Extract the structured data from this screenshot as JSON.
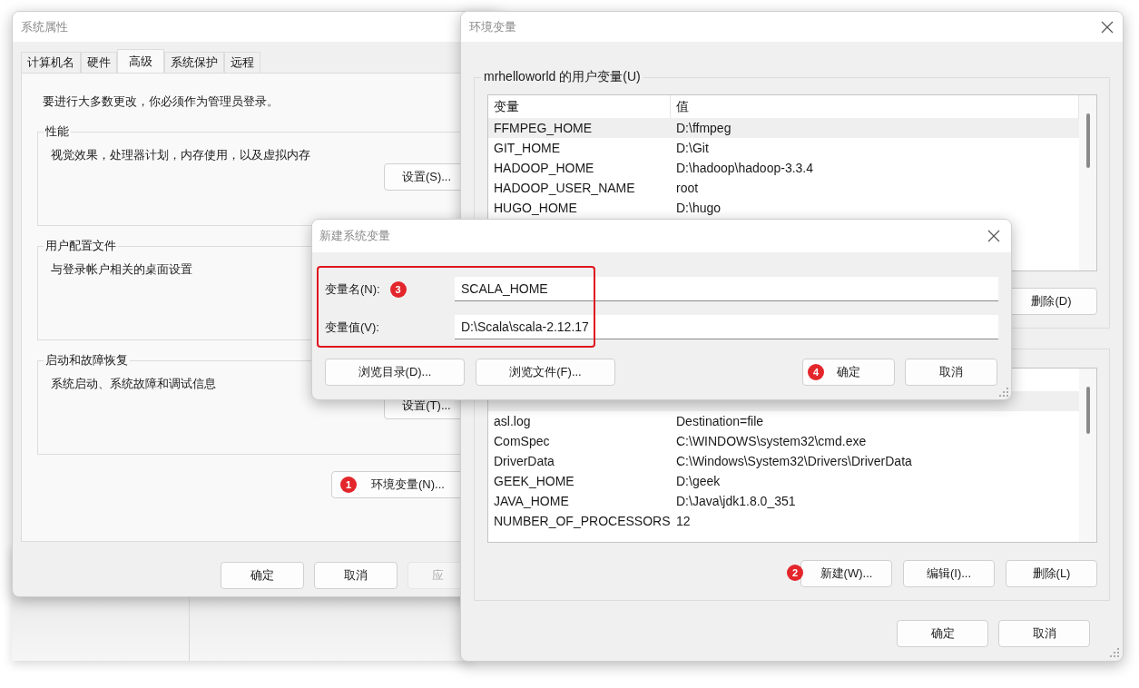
{
  "system_properties": {
    "title": "系统属性",
    "tabs": [
      {
        "label": "计算机名",
        "selected": false
      },
      {
        "label": "硬件",
        "selected": false
      },
      {
        "label": "高级",
        "selected": true
      },
      {
        "label": "系统保护",
        "selected": false
      },
      {
        "label": "远程",
        "selected": false
      }
    ],
    "notice": "要进行大多数更改，你必须作为管理员登录。",
    "groups": [
      {
        "title": "性能",
        "description": "视觉效果，处理器计划，内存使用，以及虚拟内存",
        "button": "设置(S)..."
      },
      {
        "title": "用户配置文件",
        "description": "与登录帐户相关的桌面设置"
      },
      {
        "title": "启动和故障恢复",
        "description": "系统启动、系统故障和调试信息",
        "button": "设置(T)..."
      }
    ],
    "env_button": {
      "label": "环境变量(N)...",
      "step": "1"
    },
    "buttons": [
      {
        "label": "确定",
        "disabled": false
      },
      {
        "label": "取消",
        "disabled": false
      },
      {
        "label": "应",
        "disabled": true
      }
    ]
  },
  "environment_variables": {
    "title": "环境变量",
    "user_variables": {
      "title": "mrhelloworld 的用户变量(U)",
      "columns": [
        "变量",
        "值"
      ],
      "rows": [
        {
          "name": "FFMPEG_HOME",
          "value": "D:\\ffmpeg",
          "selected": true
        },
        {
          "name": "GIT_HOME",
          "value": "D:\\Git",
          "selected": false
        },
        {
          "name": "HADOOP_HOME",
          "value": "D:\\hadoop\\hadoop-3.3.4",
          "selected": false
        },
        {
          "name": "HADOOP_USER_NAME",
          "value": "root",
          "selected": false
        },
        {
          "name": "HUGO_HOME",
          "value": "D:\\hugo",
          "selected": false
        }
      ],
      "buttons": [
        {
          "label": "删除(D)"
        }
      ]
    },
    "system_variables": {
      "rows": [
        {
          "selected": true
        },
        {
          "name": "asl.log",
          "value": "Destination=file",
          "selected": false
        },
        {
          "name": "ComSpec",
          "value": "C:\\WINDOWS\\system32\\cmd.exe",
          "selected": false
        },
        {
          "name": "DriverData",
          "value": "C:\\Windows\\System32\\Drivers\\DriverData",
          "selected": false
        },
        {
          "name": "GEEK_HOME",
          "value": "D:\\geek",
          "selected": false
        },
        {
          "name": "JAVA_HOME",
          "value": "D:\\Java\\jdk1.8.0_351",
          "selected": false
        },
        {
          "name": "NUMBER_OF_PROCESSORS",
          "value": "12",
          "selected": false
        }
      ],
      "buttons": [
        {
          "label": "新建(W)...",
          "step": "2"
        },
        {
          "label": "编辑(I)..."
        },
        {
          "label": "删除(L)"
        }
      ]
    },
    "buttons": [
      {
        "label": "确定"
      },
      {
        "label": "取消"
      }
    ]
  },
  "new_variable_dialog": {
    "title": "新建系统变量",
    "fields": [
      {
        "label": "变量名(N):",
        "value": "SCALA_HOME",
        "step": "3"
      },
      {
        "label": "变量值(V):",
        "value": "D:\\Scala\\scala-2.12.17"
      }
    ],
    "buttons": [
      {
        "label": "浏览目录(D)...",
        "kind": "left"
      },
      {
        "label": "浏览文件(F)...",
        "kind": "left"
      },
      {
        "label": "确定",
        "kind": "right",
        "step": "4"
      },
      {
        "label": "取消",
        "kind": "right"
      }
    ]
  }
}
